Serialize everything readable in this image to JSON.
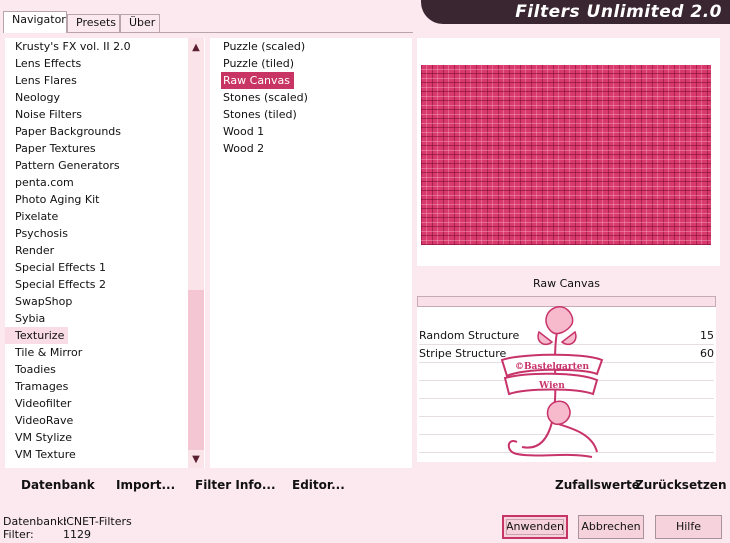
{
  "tabs": [
    {
      "label": "Navigator"
    },
    {
      "label": "Presets"
    },
    {
      "label": "Über"
    }
  ],
  "title": "Filters Unlimited 2.0",
  "categories": [
    "Krusty's FX vol. II 2.0",
    "Lens Effects",
    "Lens Flares",
    "Neology",
    "Noise Filters",
    "Paper Backgrounds",
    "Paper Textures",
    "Pattern Generators",
    "penta.com",
    "Photo Aging Kit",
    "Pixelate",
    "Psychosis",
    "Render",
    "Special Effects 1",
    "Special Effects 2",
    "SwapShop",
    "Sybia",
    "Texturize",
    "Tile & Mirror",
    "Toadies",
    "Tramages",
    "Videofilter",
    "VideoRave",
    "VM Stylize",
    "VM Texture"
  ],
  "selected_category": "Texturize",
  "filters": [
    "Puzzle (scaled)",
    "Puzzle (tiled)",
    "Raw Canvas",
    "Stones (scaled)",
    "Stones (tiled)",
    "Wood 1",
    "Wood 2"
  ],
  "selected_filter": "Raw Canvas",
  "preview_color": "#d83a6e",
  "filter_name": "Raw Canvas",
  "params": [
    {
      "label": "Random Structure",
      "value": "15"
    },
    {
      "label": "Stripe Structure",
      "value": "60"
    }
  ],
  "watermark": {
    "line1": "©Bastelgarten",
    "line2": "Wien"
  },
  "links": {
    "database": "Datenbank",
    "import": "Import...",
    "filter_info": "Filter Info...",
    "editor": "Editor...",
    "random": "Zufallswerte",
    "reset": "Zurücksetzen"
  },
  "footer": {
    "database_label": "Datenbank:",
    "database_value": "ICNET-Filters",
    "filter_label": "Filter:",
    "filter_value": "1129"
  },
  "buttons": {
    "apply": "Anwenden",
    "cancel": "Abbrechen",
    "help": "Hilfe"
  },
  "accent": "#c83565"
}
